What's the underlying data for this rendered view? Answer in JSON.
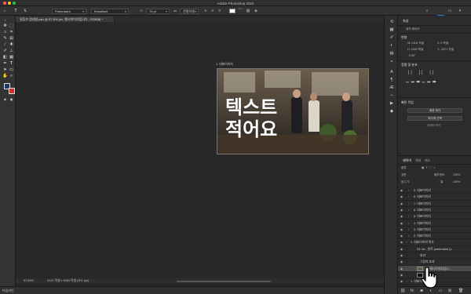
{
  "window": {
    "title": "Adobe Photoshop 2022"
  },
  "options_bar": {
    "font_family": "Pretendard",
    "font_style": "ExtraBold",
    "font_size": "70 pt",
    "antialias": "선명하게",
    "share_label": "공유"
  },
  "document": {
    "tab_title": "유튜브 썸네일.psd @ 57.8% (ex. 예시이미지입니다., RGB/8) *"
  },
  "canvas": {
    "artboard_label": "1. 대표이미지",
    "headline": "텍스트\n적어요"
  },
  "status": {
    "zoom": "57.84%",
    "doc_size": "4120 픽셀 x 8384 픽셀 (300 ppi)",
    "timeline_label": "타임라인"
  },
  "properties_panel": {
    "tabs": [
      "속성",
      "조정",
      "라이브러리"
    ],
    "artboard_label": "대지 레이어",
    "transform_title": "변형",
    "w": "W: 2404 픽셀",
    "x": "X: 0 픽셀",
    "h": "H: 1543 픽셀",
    "y": "Y: -2671 픽셀",
    "angle": "0.00°",
    "align_title": "정렬 및 분포",
    "quick_actions_title": "빠른 작업",
    "btn_remove_bg": "배경 제거",
    "btn_select_subject": "피사체 선택",
    "link_more": "자세히 보기"
  },
  "layers_panel": {
    "tabs": [
      "레이어",
      "채널",
      "패스"
    ],
    "kind_label": "종류",
    "blend_mode": "표준",
    "opacity_label": "불투명도:",
    "opacity": "100%",
    "lock_label": "잠그기:",
    "fill_label": "칠:",
    "fill": "100%",
    "rows": [
      {
        "name": "9. 대표이미지",
        "indent": 1
      },
      {
        "name": "8. 대표이미지",
        "indent": 1
      },
      {
        "name": "7. 대표이미지",
        "indent": 1
      },
      {
        "name": "6. 대표이미지",
        "indent": 1
      },
      {
        "name": "5. 대표이미지",
        "indent": 1
      },
      {
        "name": "4. 대표이미지",
        "indent": 1
      },
      {
        "name": "3. 대표이미지",
        "indent": 1
      },
      {
        "name": "2. 대표이미지",
        "indent": 1
      },
      {
        "name": "1. 대표이미지 복사",
        "indent": 0
      },
      {
        "name": "03. txt - 폰트 pretendard (x..",
        "indent": 2
      },
      {
        "name": "효과",
        "indent": 3
      },
      {
        "name": "그림자 효과",
        "indent": 3
      },
      {
        "name": "ex. 예시이미지입니...",
        "indent": 2
      },
      {
        "name": "이미지",
        "indent": 2
      },
      {
        "name": "1. 대표이...",
        "indent": 0
      }
    ]
  },
  "colors": {
    "accent": "#1473e6",
    "foreground": "#1c3b66",
    "background": "#d2302b"
  }
}
